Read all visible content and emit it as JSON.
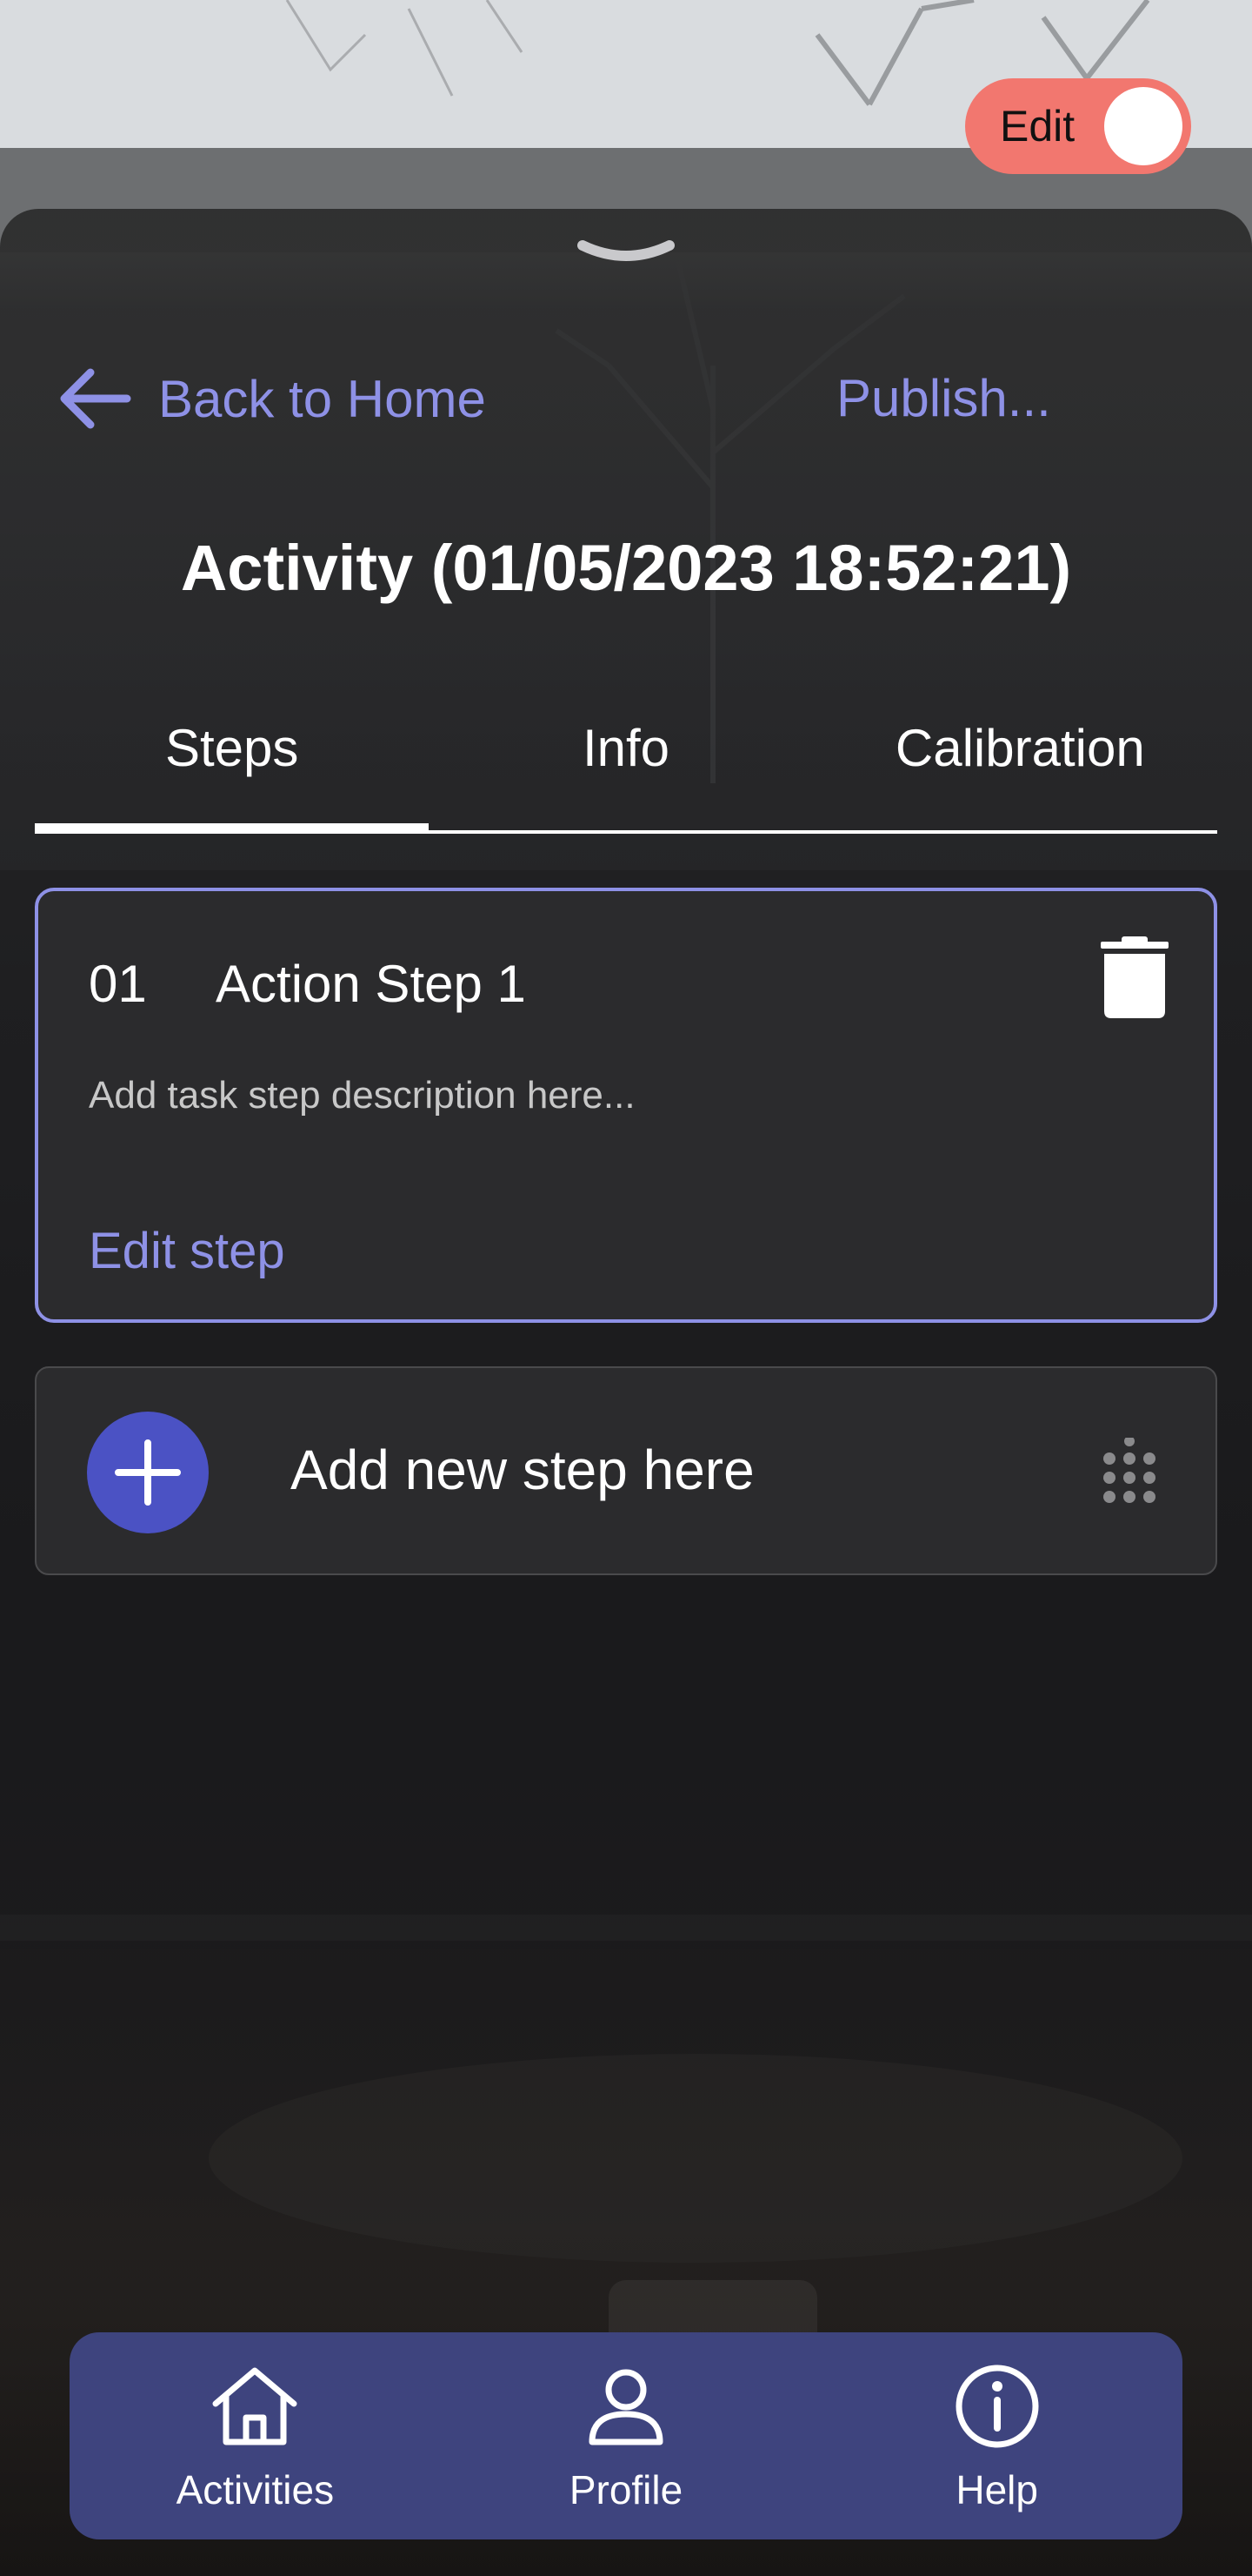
{
  "edit_toggle": {
    "label": "Edit",
    "state": "on",
    "color": "#f2776f"
  },
  "header": {
    "back_label": "Back to Home",
    "back_icon": "arrow-left-icon",
    "publish_label": "Publish..."
  },
  "activity_title": "Activity (01/05/2023 18:52:21)",
  "tabs": [
    {
      "label": "Steps",
      "active": true
    },
    {
      "label": "Info",
      "active": false
    },
    {
      "label": "Calibration",
      "active": false
    }
  ],
  "steps": [
    {
      "number": "01",
      "name": "Action Step 1",
      "description": "Add task step description here...",
      "edit_label": "Edit step",
      "delete_icon": "trash-icon"
    }
  ],
  "add_step": {
    "label": "Add new step here",
    "icon": "plus-icon",
    "grip_icon": "drag-grip-icon"
  },
  "bottom_nav": [
    {
      "label": "Activities",
      "icon": "home-icon"
    },
    {
      "label": "Profile",
      "icon": "person-icon"
    },
    {
      "label": "Help",
      "icon": "info-icon"
    }
  ],
  "colors": {
    "accent": "#8e91e6",
    "add_button": "#4b52c4",
    "nav_background": "#3e447e",
    "toggle": "#f2776f"
  }
}
